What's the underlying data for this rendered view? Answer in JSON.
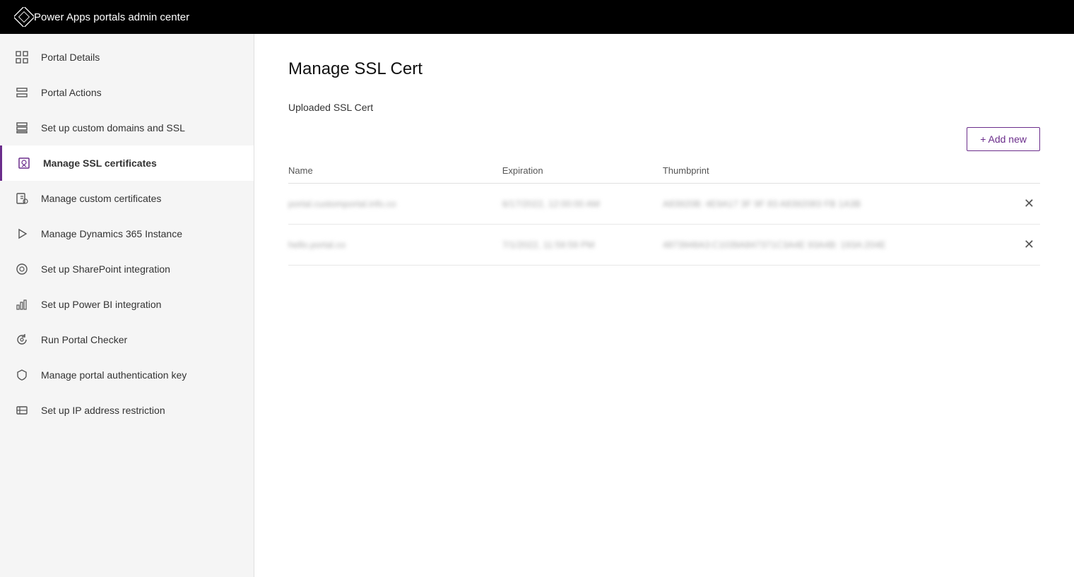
{
  "topbar": {
    "title": "Power Apps portals admin center",
    "logo_label": "power-apps-logo"
  },
  "sidebar": {
    "items": [
      {
        "id": "portal-details",
        "label": "Portal Details",
        "icon": "grid-icon",
        "active": false
      },
      {
        "id": "portal-actions",
        "label": "Portal Actions",
        "icon": "layers-icon",
        "active": false
      },
      {
        "id": "custom-domains-ssl",
        "label": "Set up custom domains and SSL",
        "icon": "stack-icon",
        "active": false
      },
      {
        "id": "manage-ssl-certs",
        "label": "Manage SSL certificates",
        "icon": "cert-icon",
        "active": true
      },
      {
        "id": "manage-custom-certs",
        "label": "Manage custom certificates",
        "icon": "custom-cert-icon",
        "active": false
      },
      {
        "id": "manage-dynamics",
        "label": "Manage Dynamics 365 Instance",
        "icon": "play-icon",
        "active": false
      },
      {
        "id": "sharepoint-integration",
        "label": "Set up SharePoint integration",
        "icon": "sharepoint-icon",
        "active": false
      },
      {
        "id": "power-bi-integration",
        "label": "Set up Power BI integration",
        "icon": "bar-chart-icon",
        "active": false
      },
      {
        "id": "portal-checker",
        "label": "Run Portal Checker",
        "icon": "refresh-icon",
        "active": false
      },
      {
        "id": "auth-key",
        "label": "Manage portal authentication key",
        "icon": "shield-icon",
        "active": false
      },
      {
        "id": "ip-restriction",
        "label": "Set up IP address restriction",
        "icon": "ip-icon",
        "active": false
      }
    ]
  },
  "content": {
    "page_title": "Manage SSL Cert",
    "section_title": "Uploaded SSL Cert",
    "add_new_label": "+ Add new",
    "table": {
      "headers": {
        "name": "Name",
        "expiration": "Expiration",
        "thumbprint": "Thumbprint"
      },
      "rows": [
        {
          "name": "portal.customportal.info.co",
          "expiration": "6/17/2022, 12:00:00 AM",
          "thumbprint": "A83920B: 4E9A17 3F 9F 83 A8392083 FB 1A3B"
        },
        {
          "name": "hello.portal.co",
          "expiration": "7/1/2022, 11:59:59 PM",
          "thumbprint": "4873948A3:C1039A847371C3A4E 93A4B: 193A:204E"
        }
      ]
    }
  }
}
